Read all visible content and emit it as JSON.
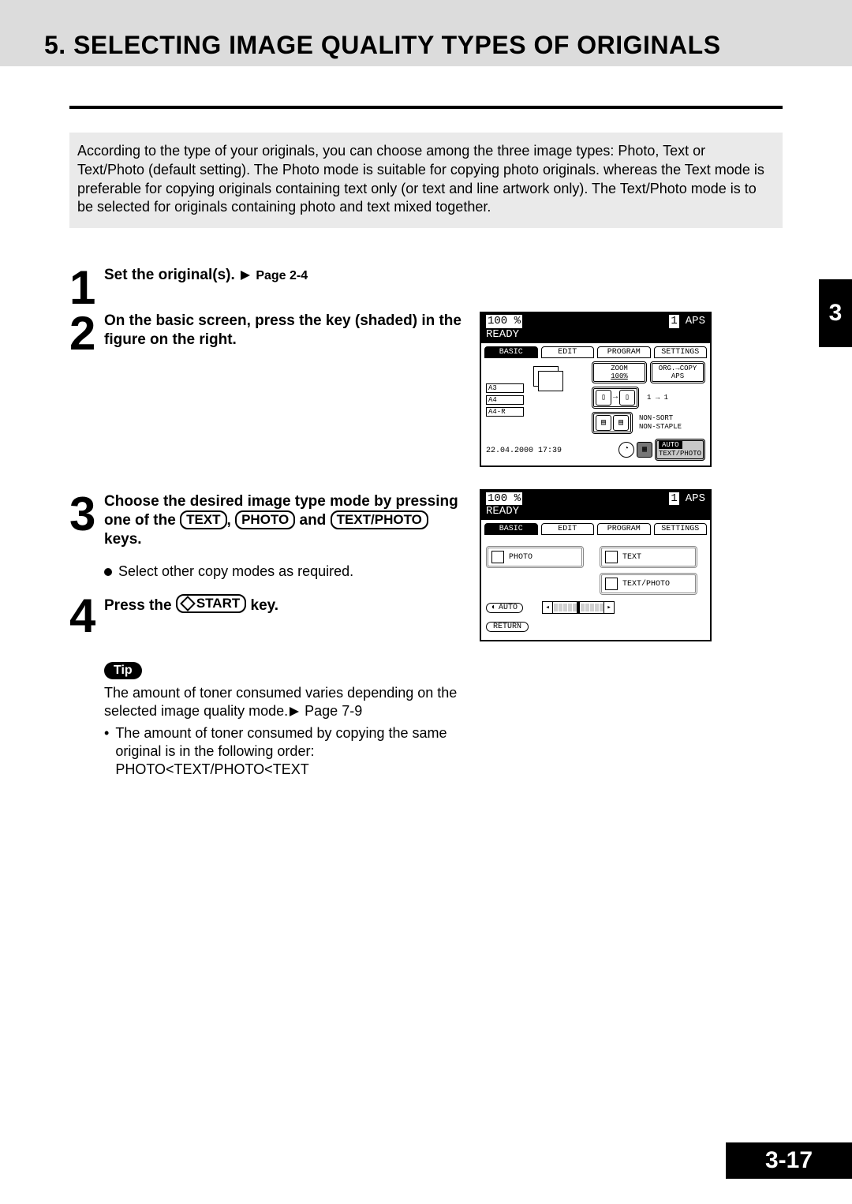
{
  "title": "5. SELECTING IMAGE QUALITY TYPES OF ORIGINALS",
  "intro": "According to the type of your originals, you can choose among the three image types: Photo, Text or Text/Photo (default setting). The Photo mode is suitable for copying photo originals. whereas the Text mode is preferable for copying originals containing text only (or text and line artwork only). The Text/Photo mode is to be selected for originals containing photo and text mixed together.",
  "steps": {
    "s1": {
      "num": "1",
      "text": "Set the original(s).",
      "page_ref": "Page 2-4"
    },
    "s2": {
      "num": "2",
      "text": "On the basic screen, press the key (shaded) in the figure on the right."
    },
    "s3": {
      "num": "3",
      "lead": "Choose the desired image type mode by pressing one of the ",
      "k1": "TEXT",
      "sep1": ", ",
      "k2": "PHOTO",
      "sep2": " and ",
      "k3": "TEXT/PHOTO",
      "tail": " keys.",
      "sub": "Select other copy modes as required."
    },
    "s4": {
      "num": "4",
      "lead": "Press the ",
      "key": "START",
      "tail": " key."
    }
  },
  "tip": {
    "label": "Tip",
    "line1": "The amount of toner consumed varies depending on the selected image quality mode.",
    "page_ref": "Page 7-9",
    "bullet": "The amount of toner consumed by copying the same original is in the following order:",
    "order": "PHOTO<TEXT/PHOTO<TEXT"
  },
  "side_tab": "3",
  "page_number": "3-17",
  "panel1": {
    "zoom_pct": "100 %",
    "copies": "1",
    "mode_abbr": "APS",
    "status": "READY",
    "tabs": {
      "basic": "BASIC",
      "edit": "EDIT",
      "program": "PROGRAM",
      "settings": "SETTINGS"
    },
    "trays": {
      "a3": "A3",
      "a4": "A4",
      "a4r": "A4-R"
    },
    "zoom_label": "ZOOM",
    "zoom_val": "100%",
    "org_copy": "ORG.→COPY",
    "aps": "APS",
    "one_to_one": "1 → 1",
    "sort": "NON-SORT",
    "staple": "NON-STAPLE",
    "timestamp": "22.04.2000 17:39",
    "auto": "AUTO",
    "textphoto": "TEXT/PHOTO"
  },
  "panel2": {
    "zoom_pct": "100 %",
    "copies": "1",
    "mode_abbr": "APS",
    "status": "READY",
    "tabs": {
      "basic": "BASIC",
      "edit": "EDIT",
      "program": "PROGRAM",
      "settings": "SETTINGS"
    },
    "modes": {
      "photo": "PHOTO",
      "text": "TEXT",
      "textphoto": "TEXT/PHOTO"
    },
    "auto": "AUTO",
    "return": "RETURN"
  }
}
